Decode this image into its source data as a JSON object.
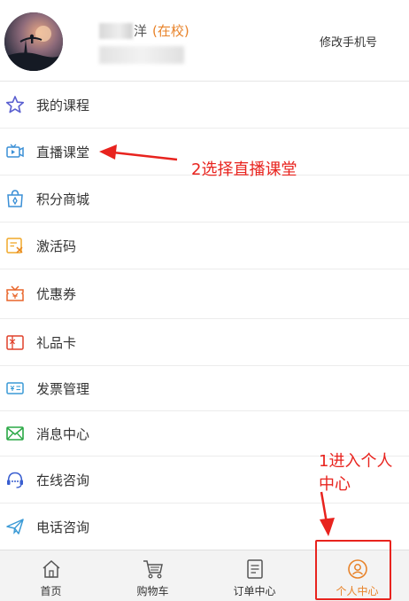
{
  "profile": {
    "name_visible_char": "洋",
    "status": "(在校)",
    "edit_phone_label": "修改手机号"
  },
  "menu": {
    "items": [
      {
        "label": "我的课程",
        "icon": "star-icon"
      },
      {
        "label": "直播课堂",
        "icon": "live-video-icon"
      },
      {
        "label": "积分商城",
        "icon": "shopping-bag-icon"
      },
      {
        "label": "激活码",
        "icon": "activation-code-icon"
      },
      {
        "label": "优惠券",
        "icon": "coupon-icon"
      },
      {
        "label": "礼品卡",
        "icon": "gift-card-icon"
      },
      {
        "label": "发票管理",
        "icon": "invoice-icon"
      },
      {
        "label": "消息中心",
        "icon": "mail-icon"
      },
      {
        "label": "在线咨询",
        "icon": "headset-icon"
      },
      {
        "label": "电话咨询",
        "icon": "paper-plane-icon"
      }
    ]
  },
  "annotations": {
    "step1": "1进入个人中心",
    "step1_line1": "1进入个人",
    "step1_line2": "中心",
    "step2": "2选择直播课堂"
  },
  "tabbar": {
    "tabs": [
      {
        "label": "首页",
        "icon": "home-icon"
      },
      {
        "label": "购物车",
        "icon": "cart-icon"
      },
      {
        "label": "订单中心",
        "icon": "order-list-icon"
      },
      {
        "label": "个人中心",
        "icon": "user-icon"
      }
    ],
    "active_index": 3
  },
  "colors": {
    "accent_orange": "#e8832a",
    "annotation_red": "#e8231e",
    "tabbar_bg": "#f3f3f3"
  }
}
